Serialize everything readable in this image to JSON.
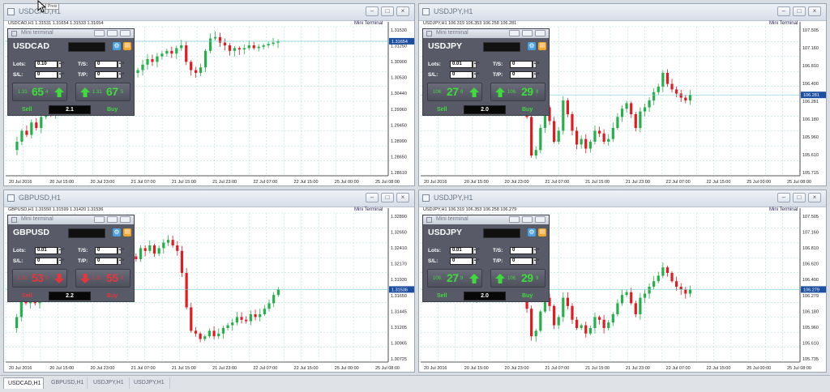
{
  "colors": {
    "bull": "#25b04a",
    "bear": "#e21b23",
    "grid": "#b3e3e0",
    "price_line": "#1c4fa0",
    "sell_red": "#e5363b",
    "buy_green": "#3ddc3a"
  },
  "icons": {
    "gear": "gear-icon",
    "chart": "chart-icon",
    "arrow_up": "arrow-up-icon",
    "arrow_down": "arrow-down-icon",
    "cursor": "mouse-cursor-icon"
  },
  "cursor_tooltip": "Preis",
  "windows": [
    {
      "title": "USDCAD,H1",
      "header": "USDCAD,H1   1.31531 1.31654 1.31533 1.31654",
      "mini_label": "Mini Terminal",
      "yticks": [
        "1.31530",
        "1.31250",
        "1.30900",
        "1.30530",
        "1.30440",
        "1.29960",
        "1.29450",
        "1.28990",
        "1.28650",
        "1.28610"
      ],
      "price_tag": "1.31654",
      "xticks": [
        "20 Jul 2016",
        "20 Jul 15:00",
        "20 Jul 23:00",
        "21 Jul 07:00",
        "21 Jul 15:00",
        "21 Jul 23:00",
        "22 Jul 07:00",
        "22 Jul 15:00",
        "25 Jul 00:00",
        "25 Jul 08:00"
      ],
      "terminal": {
        "title": "Mini terminal",
        "symbol": "USDCAD",
        "lots": "0.10",
        "sl": "0",
        "ts": "0",
        "tp": "0",
        "sell_pre": "1.31",
        "sell_big": "65",
        "sell_sup": "4",
        "buy_pre": "1.31",
        "buy_big": "67",
        "buy_sup": "5",
        "sell_label": "Sell",
        "buy_label": "Buy",
        "lot_display": "2.1",
        "direction": "up"
      }
    },
    {
      "title": "USDJPY,H1",
      "header": "USDJPY,H1   106.319 106.353 106.258 106.281",
      "mini_label": "Mini Terminal",
      "yticks": [
        "107.505",
        "107.160",
        "106.810",
        "106.400",
        "106.281",
        "106.180",
        "105.960",
        "105.610",
        "105.715"
      ],
      "price_tag": "106.281",
      "xticks": [
        "20 Jul 2016",
        "20 Jul 15:00",
        "20 Jul 23:00",
        "21 Jul 07:00",
        "21 Jul 15:00",
        "21 Jul 23:00",
        "22 Jul 07:00",
        "22 Jul 15:00",
        "25 Jul 00:00",
        "25 Jul 08:00"
      ],
      "terminal": {
        "title": "Mini terminal",
        "symbol": "USDJPY",
        "lots": "0.01",
        "sl": "0",
        "ts": "0",
        "tp": "0",
        "sell_pre": "106.",
        "sell_big": "27",
        "sell_sup": "9",
        "buy_pre": "106.",
        "buy_big": "29",
        "buy_sup": "9",
        "sell_label": "Sell",
        "buy_label": "Buy",
        "lot_display": "2.0",
        "direction": "up"
      }
    },
    {
      "title": "GBPUSD,H1",
      "header": "GBPUSD,H1   1.31550 1.31599 1.31420 1.31536",
      "mini_label": "Mini Terminal",
      "yticks": [
        "1.32890",
        "1.32650",
        "1.32410",
        "1.32170",
        "1.31930",
        "1.31650",
        "1.31445",
        "1.31205",
        "1.30965",
        "1.30725"
      ],
      "price_tag": "1.31536",
      "xticks": [
        "20 Jul 2016",
        "20 Jul 15:00",
        "20 Jul 23:00",
        "21 Jul 07:00",
        "21 Jul 15:00",
        "21 Jul 23:00",
        "22 Jul 07:00",
        "22 Jul 15:00",
        "25 Jul 00:00",
        "25 Jul 08:00"
      ],
      "terminal": {
        "title": "Mini terminal",
        "symbol": "GBPUSD",
        "lots": "0.01",
        "sl": "0",
        "ts": "0",
        "tp": "0",
        "sell_pre": "1.31",
        "sell_big": "53",
        "sell_sup": "6",
        "buy_pre": "1.31",
        "buy_big": "55",
        "buy_sup": "8",
        "sell_label": "Sell",
        "buy_label": "Buy",
        "lot_display": "2.2",
        "direction": "down"
      }
    },
    {
      "title": "USDJPY,H1",
      "header": "USDJPY,H1   106.319 106.353 106.258 106.279",
      "mini_label": "Mini Terminal",
      "yticks": [
        "107.505",
        "107.160",
        "106.810",
        "106.620",
        "106.400",
        "106.279",
        "106.180",
        "105.960",
        "105.610",
        "105.735"
      ],
      "price_tag": "106.279",
      "xticks": [
        "20 Jul 2016",
        "20 Jul 15:00",
        "20 Jul 23:00",
        "21 Jul 07:00",
        "21 Jul 15:00",
        "21 Jul 23:00",
        "22 Jul 07:00",
        "22 Jul 15:00",
        "25 Jul 00:00",
        "25 Jul 08:00"
      ],
      "terminal": {
        "title": "Mini terminal",
        "symbol": "USDJPY",
        "lots": "0.01",
        "sl": "0",
        "ts": "0",
        "tp": "0",
        "sell_pre": "106.",
        "sell_big": "27",
        "sell_sup": "9",
        "buy_pre": "106.",
        "buy_big": "29",
        "buy_sup": "9",
        "sell_label": "Sell",
        "buy_label": "Buy",
        "lot_display": "2.0",
        "direction": "up"
      }
    }
  ],
  "tabs": [
    {
      "label": "USDCAD,H1",
      "active": true
    },
    {
      "label": "GBPUSD,H1",
      "active": false
    },
    {
      "label": "USDJPY,H1",
      "active": false
    },
    {
      "label": "USDJPY,H1",
      "active": false
    }
  ]
}
